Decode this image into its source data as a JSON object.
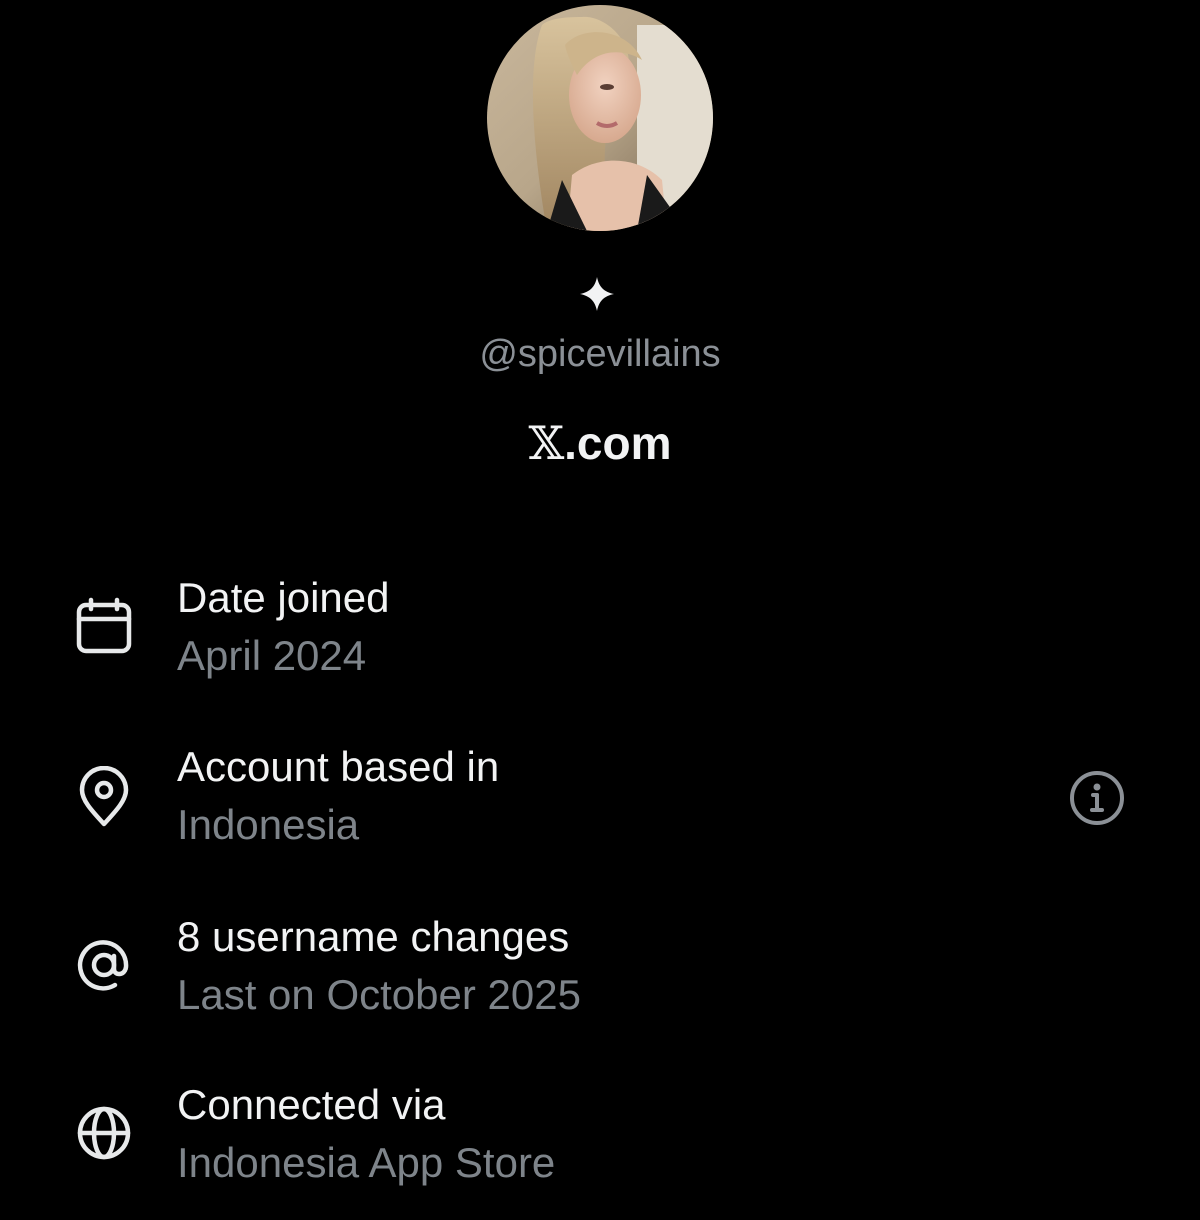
{
  "profile": {
    "handle": "@spicevillains",
    "site_prefix": "𝕏",
    "site_suffix": ".com"
  },
  "details": [
    {
      "icon": "calendar-icon",
      "title": "Date joined",
      "value": "April 2024"
    },
    {
      "icon": "location-pin-icon",
      "title": "Account based in",
      "value": "Indonesia"
    },
    {
      "icon": "at-sign-icon",
      "title": "8 username changes",
      "value": "Last on October 2025"
    },
    {
      "icon": "globe-icon",
      "title": "Connected via",
      "value": "Indonesia App Store"
    }
  ],
  "colors": {
    "background": "#000000",
    "primary_text": "#f2f3f4",
    "secondary_text": "#7e848a",
    "handle_text": "#8b9096"
  }
}
